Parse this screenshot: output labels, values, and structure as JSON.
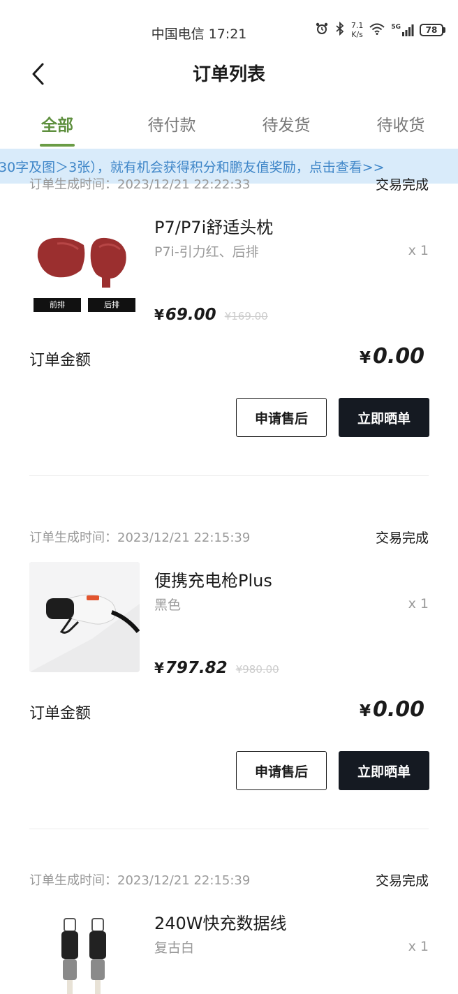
{
  "status_bar": {
    "carrier_time": "中国电信 17:21",
    "alarm_icon": "alarm-clock-icon",
    "bluetooth_icon": "bluetooth-icon",
    "net_speed_value": "7.1",
    "net_speed_unit": "K/s",
    "wifi_icon": "wifi-icon",
    "signal_label": "5G",
    "battery": "78"
  },
  "header": {
    "title": "订单列表",
    "back_icon": "chevron-left-icon"
  },
  "tabs": [
    {
      "label": "全部",
      "active": true
    },
    {
      "label": "待付款",
      "active": false
    },
    {
      "label": "待发货",
      "active": false
    },
    {
      "label": "待收货",
      "active": false
    }
  ],
  "notice": {
    "text": "30字及图＞3张），就有机会获得积分和鹏友值奖励，点击查看>>"
  },
  "orders": [
    {
      "time": "订单生成时间：2023/12/21 22:22:33",
      "status": "交易完成",
      "product_name": "P7/P7i舒适头枕",
      "variant": "P7i-引力红、后排",
      "qty": "x 1",
      "currency": "¥",
      "price": "69.00",
      "original_price": "¥169.00",
      "thumb_labels": [
        "前排",
        "后排"
      ],
      "total_label": "订单金额",
      "total_currency": "¥",
      "total": "0.00",
      "btn_after_sale": "申请售后",
      "btn_review": "立即晒单"
    },
    {
      "time": "订单生成时间：2023/12/21 22:15:39",
      "status": "交易完成",
      "product_name": "便携充电枪Plus",
      "variant": "黑色",
      "qty": "x 1",
      "currency": "¥",
      "price": "797.82",
      "original_price": "¥980.00",
      "total_label": "订单金额",
      "total_currency": "¥",
      "total": "0.00",
      "btn_after_sale": "申请售后",
      "btn_review": "立即晒单"
    },
    {
      "time": "订单生成时间：2023/12/21 22:15:39",
      "status": "交易完成",
      "product_name": "240W快充数据线",
      "variant": "复古白",
      "qty": "x 1"
    }
  ],
  "colors": {
    "accent_green": "#5e8f3e",
    "notice_bg": "#d9ebfa",
    "notice_text": "#3f86c8",
    "dark_button": "#151a22",
    "headrest_red": "#9b2f2f"
  }
}
